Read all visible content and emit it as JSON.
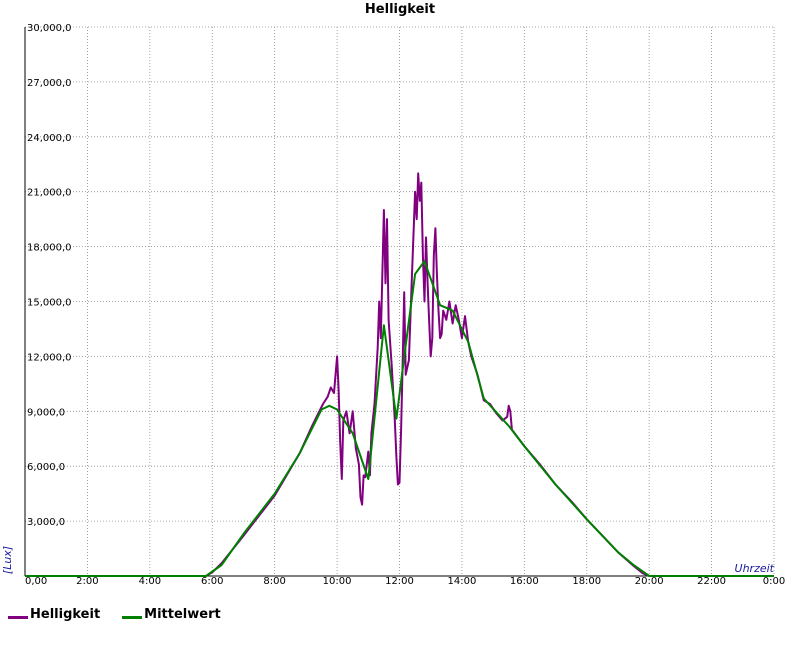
{
  "chart_data": {
    "type": "line",
    "title": "Helligkeit",
    "xlabel": "Uhrzeit",
    "ylabel": "[Lux]",
    "xlim": [
      0,
      24
    ],
    "ylim": [
      0,
      30000
    ],
    "grid": true,
    "legend_position": "bottom-left",
    "x_ticks": [
      {
        "x": 0,
        "label": "0,00"
      },
      {
        "x": 2,
        "label": "2:00"
      },
      {
        "x": 4,
        "label": "4:00"
      },
      {
        "x": 6,
        "label": "6:00"
      },
      {
        "x": 8,
        "label": "8:00"
      },
      {
        "x": 10,
        "label": "10:00"
      },
      {
        "x": 12,
        "label": "12:00"
      },
      {
        "x": 14,
        "label": "14:00"
      },
      {
        "x": 16,
        "label": "16:00"
      },
      {
        "x": 18,
        "label": "18:00"
      },
      {
        "x": 20,
        "label": "20:00"
      },
      {
        "x": 22,
        "label": "22:00"
      },
      {
        "x": 24,
        "label": "0:00"
      }
    ],
    "y_ticks": [
      {
        "y": 3000,
        "label": "3,000,0"
      },
      {
        "y": 6000,
        "label": "6,000,0"
      },
      {
        "y": 9000,
        "label": "9,000,0"
      },
      {
        "y": 12000,
        "label": "12,000,0"
      },
      {
        "y": 15000,
        "label": "15,000,0"
      },
      {
        "y": 18000,
        "label": "18,000,0"
      },
      {
        "y": 21000,
        "label": "21,000,0"
      },
      {
        "y": 24000,
        "label": "24,000,0"
      },
      {
        "y": 27000,
        "label": "27,000,0"
      },
      {
        "y": 30000,
        "label": "30,000,0"
      }
    ],
    "series": [
      {
        "name": "Helligkeit",
        "color": "#800080",
        "points": [
          [
            0,
            0
          ],
          [
            5.8,
            0
          ],
          [
            6.0,
            200
          ],
          [
            6.3,
            700
          ],
          [
            7.0,
            2200
          ],
          [
            8.0,
            4400
          ],
          [
            8.8,
            6700
          ],
          [
            9.2,
            8200
          ],
          [
            9.55,
            9400
          ],
          [
            9.7,
            9800
          ],
          [
            9.8,
            10300
          ],
          [
            9.9,
            10000
          ],
          [
            10.0,
            12000
          ],
          [
            10.05,
            10200
          ],
          [
            10.1,
            7300
          ],
          [
            10.15,
            5300
          ],
          [
            10.2,
            8500
          ],
          [
            10.3,
            9000
          ],
          [
            10.4,
            7800
          ],
          [
            10.5,
            9000
          ],
          [
            10.6,
            7000
          ],
          [
            10.7,
            6100
          ],
          [
            10.75,
            4300
          ],
          [
            10.8,
            3900
          ],
          [
            10.85,
            5500
          ],
          [
            10.9,
            5400
          ],
          [
            11.0,
            6800
          ],
          [
            11.05,
            5500
          ],
          [
            11.1,
            7800
          ],
          [
            11.2,
            9400
          ],
          [
            11.3,
            12500
          ],
          [
            11.35,
            15000
          ],
          [
            11.4,
            13000
          ],
          [
            11.5,
            20000
          ],
          [
            11.55,
            16000
          ],
          [
            11.6,
            19500
          ],
          [
            11.65,
            14000
          ],
          [
            11.75,
            11500
          ],
          [
            11.85,
            8500
          ],
          [
            11.9,
            6500
          ],
          [
            11.95,
            5000
          ],
          [
            12.0,
            5100
          ],
          [
            12.05,
            8000
          ],
          [
            12.1,
            11500
          ],
          [
            12.15,
            15500
          ],
          [
            12.2,
            11000
          ],
          [
            12.3,
            11800
          ],
          [
            12.4,
            16500
          ],
          [
            12.5,
            21000
          ],
          [
            12.55,
            19500
          ],
          [
            12.6,
            22000
          ],
          [
            12.65,
            20500
          ],
          [
            12.7,
            21500
          ],
          [
            12.75,
            17500
          ],
          [
            12.8,
            15000
          ],
          [
            12.85,
            18500
          ],
          [
            12.9,
            16000
          ],
          [
            12.95,
            14000
          ],
          [
            13.0,
            12000
          ],
          [
            13.05,
            13000
          ],
          [
            13.1,
            17500
          ],
          [
            13.15,
            19000
          ],
          [
            13.2,
            16500
          ],
          [
            13.25,
            14500
          ],
          [
            13.3,
            13000
          ],
          [
            13.35,
            13200
          ],
          [
            13.4,
            14500
          ],
          [
            13.5,
            14000
          ],
          [
            13.6,
            15000
          ],
          [
            13.7,
            13800
          ],
          [
            13.8,
            14800
          ],
          [
            13.9,
            14000
          ],
          [
            14.0,
            13000
          ],
          [
            14.1,
            14200
          ],
          [
            14.2,
            12800
          ],
          [
            14.3,
            12000
          ],
          [
            14.5,
            11000
          ],
          [
            14.7,
            9600
          ],
          [
            14.9,
            9400
          ],
          [
            15.1,
            8900
          ],
          [
            15.3,
            8500
          ],
          [
            15.45,
            8700
          ],
          [
            15.5,
            9300
          ],
          [
            15.55,
            9000
          ],
          [
            15.6,
            8000
          ],
          [
            16.0,
            7100
          ],
          [
            16.5,
            6100
          ],
          [
            17.0,
            5000
          ],
          [
            17.5,
            4100
          ],
          [
            18.0,
            3100
          ],
          [
            18.5,
            2200
          ],
          [
            19.0,
            1300
          ],
          [
            19.5,
            550
          ],
          [
            19.8,
            150
          ],
          [
            20.0,
            0
          ],
          [
            24,
            0
          ]
        ]
      },
      {
        "name": "Mittelwert",
        "color": "#008000",
        "points": [
          [
            0,
            0
          ],
          [
            5.8,
            0
          ],
          [
            6.3,
            600
          ],
          [
            7.0,
            2300
          ],
          [
            8.0,
            4500
          ],
          [
            8.8,
            6700
          ],
          [
            9.5,
            9100
          ],
          [
            9.75,
            9300
          ],
          [
            10.0,
            9100
          ],
          [
            10.5,
            7800
          ],
          [
            11.0,
            5300
          ],
          [
            11.5,
            13700
          ],
          [
            11.9,
            8600
          ],
          [
            12.2,
            12600
          ],
          [
            12.5,
            16500
          ],
          [
            12.8,
            17200
          ],
          [
            13.3,
            14800
          ],
          [
            13.7,
            14500
          ],
          [
            14.2,
            12800
          ],
          [
            14.7,
            9700
          ],
          [
            15.5,
            8200
          ],
          [
            16.0,
            7100
          ],
          [
            17.0,
            5000
          ],
          [
            18.0,
            3100
          ],
          [
            19.0,
            1300
          ],
          [
            19.5,
            600
          ],
          [
            20.0,
            0
          ],
          [
            24,
            0
          ]
        ]
      }
    ]
  }
}
